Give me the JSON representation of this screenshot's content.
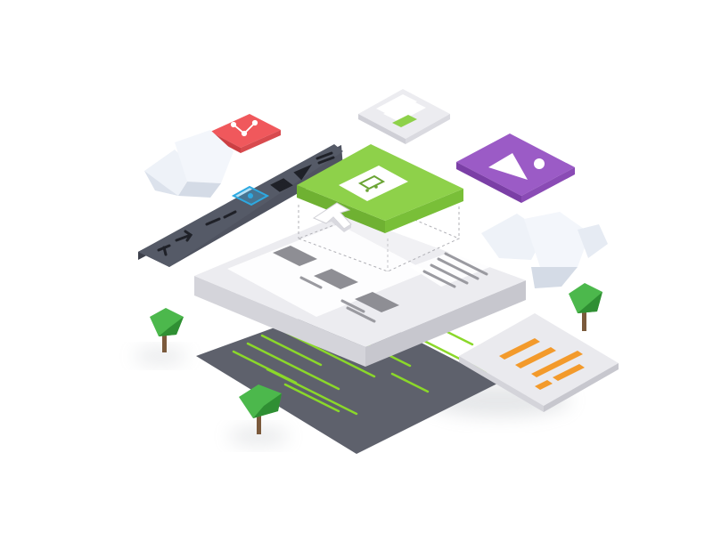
{
  "illustration": {
    "kind": "isometric-web-design-layers",
    "colors": {
      "background": "#ffffff",
      "page_top": "#e8e8ec",
      "page_side_left": "#d4d4da",
      "page_side_right": "#c7c7ce",
      "placeholder_block": "#8e8e94",
      "text_line": "#9a9aa0",
      "dark_layer": "#5e616c",
      "dark_layer_edge": "#4a4d57",
      "code_line": "#8bd82a",
      "green_card": "#8ed14a",
      "green_card_side": "#6fb132",
      "red_card": "#f0585c",
      "red_card_side": "#cc3f43",
      "purple_card": "#9b5bc6",
      "purple_card_side": "#7b3fa6",
      "orange_bar": "#f39a2b",
      "toolbar": "#4f5360",
      "toolbar_side": "#3d404b",
      "toolbar_selected": "#2da9e1",
      "tree_leaf": "#4cb84c",
      "tree_leaf_dark": "#2f8f33",
      "tree_trunk": "#7b5a3c",
      "cloud": "#eef2f8",
      "cloud_shade": "#d4dbe6"
    },
    "icons": [
      "vector-path-icon",
      "shopping-cart-icon",
      "image-placeholder-icon",
      "mouse-pointer-icon",
      "text-tool-icon",
      "arrow-tool-icon",
      "pen-tool-icon",
      "brush-tool-icon",
      "selection-tool-icon",
      "shape-tool-icon",
      "play-icon",
      "menu-icon"
    ]
  }
}
